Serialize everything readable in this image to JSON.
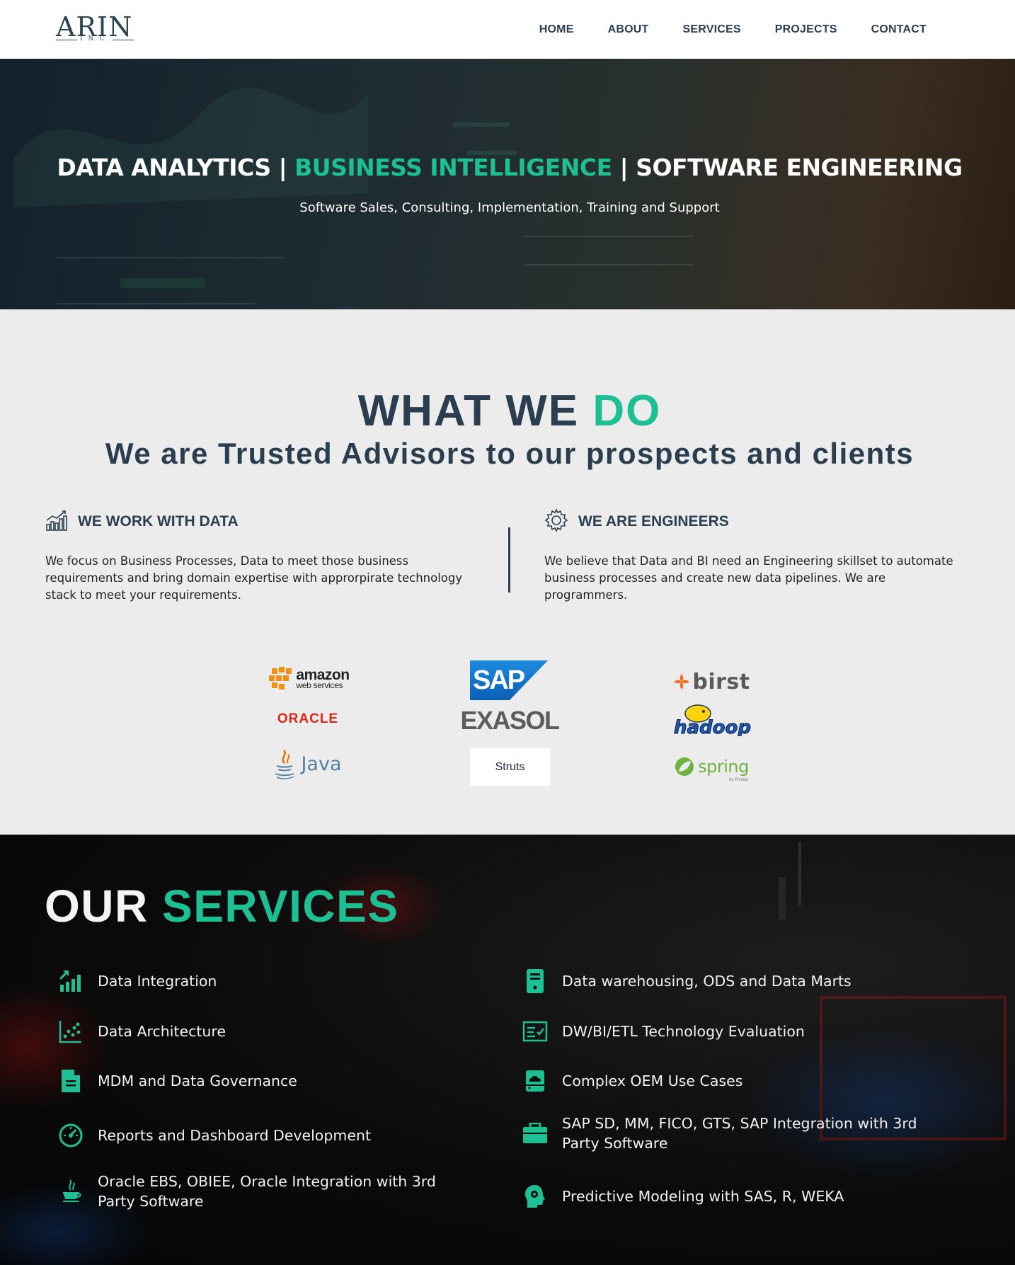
{
  "brand": {
    "logo_main": "ARIN",
    "logo_sub": "INC"
  },
  "nav": {
    "items": [
      "HOME",
      "ABOUT",
      "SERVICES",
      "PROJECTS",
      "CONTACT"
    ]
  },
  "hero": {
    "title_part1": "DATA ANALYTICS",
    "separator": "|",
    "title_part2": "BUSINESS INTELLIGENCE",
    "title_part3": "SOFTWARE ENGINEERING",
    "subtitle": "Software Sales, Consulting, Implementation, Training and Support"
  },
  "what_we_do": {
    "title_main": "WHAT WE",
    "title_highlight": "DO",
    "subtitle": "We are Trusted Advisors to our prospects and clients",
    "columns": [
      {
        "icon": "bar-chart-growth-icon",
        "heading": "WE WORK WITH DATA",
        "body": "We focus on Business Processes, Data to meet those business requirements and bring domain expertise with approrpirate technology stack to meet your requirements."
      },
      {
        "icon": "gear-icon",
        "heading": "WE ARE ENGINEERS",
        "body": "We believe that Data and BI need an Engineering skillset to automate business processes and create new data pipelines. We are programmers."
      }
    ],
    "partner_logos": {
      "amazon": {
        "line1": "amazon",
        "line2": "web services"
      },
      "sap": "SAP",
      "birst": "birst",
      "oracle": "ORACLE",
      "exasol": "EXASOL",
      "hadoop": "hadoop",
      "java": "Java",
      "struts": "Struts",
      "spring": {
        "name": "spring",
        "tagline": "by Pivotal."
      }
    }
  },
  "services": {
    "title_main": "OUR",
    "title_highlight": "SERVICES",
    "left": [
      {
        "icon": "growth-bars-icon",
        "label": "Data Integration"
      },
      {
        "icon": "scatter-chart-icon",
        "label": "Data Architecture"
      },
      {
        "icon": "document-icon",
        "label": "MDM and Data Governance"
      },
      {
        "icon": "speedometer-icon",
        "label": "Reports and Dashboard Development"
      },
      {
        "icon": "java-cup-icon",
        "label": "Oracle EBS, OBIEE, Oracle Integration with 3rd Party Software"
      }
    ],
    "right": [
      {
        "icon": "server-icon",
        "label": "Data warehousing, ODS and Data Marts"
      },
      {
        "icon": "checklist-icon",
        "label": "DW/BI/ETL Technology Evaluation"
      },
      {
        "icon": "cloud-storage-icon",
        "label": "Complex OEM Use Cases"
      },
      {
        "icon": "briefcase-icon",
        "label": "SAP SD, MM, FICO, GTS, SAP Integration with 3rd Party Software"
      },
      {
        "icon": "brain-gear-icon",
        "label": "Predictive Modeling with SAS, R, WEKA"
      }
    ]
  },
  "colors": {
    "accent": "#1fbf94",
    "navy": "#2b3e50",
    "section_bg": "#ececec"
  }
}
